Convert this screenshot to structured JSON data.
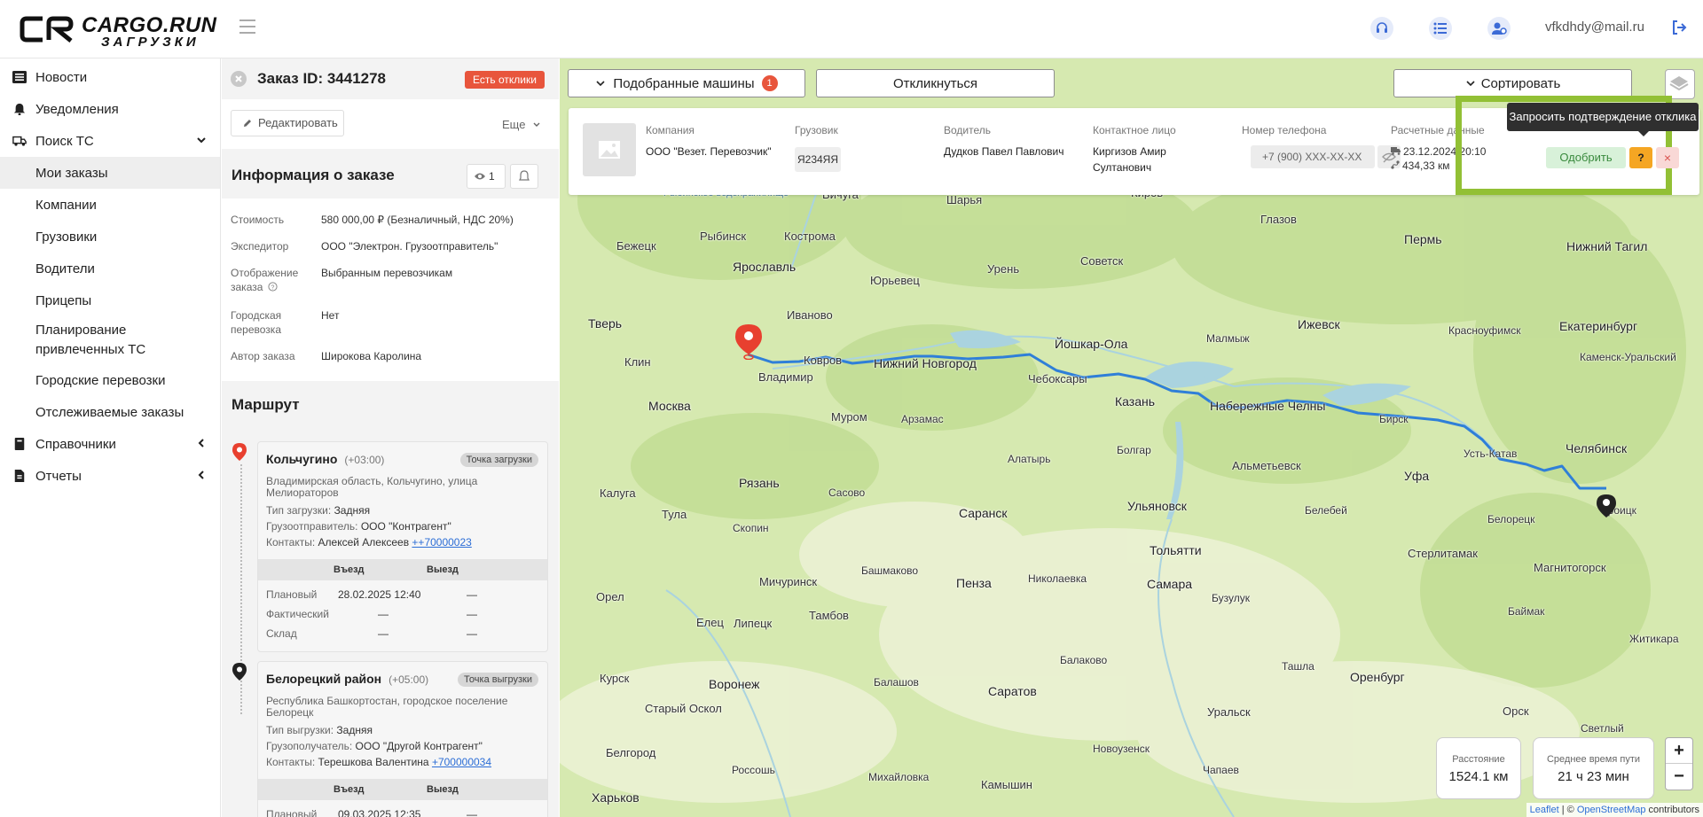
{
  "header": {
    "logo_top": "CARGO.RUN",
    "logo_bottom": "ЗАГРУЗКИ",
    "email": "vfkdhdy@mail.ru",
    "icons": [
      "support-icon",
      "list-icon",
      "user-settings-icon",
      "logout-icon"
    ]
  },
  "sidebar": {
    "items": [
      {
        "label": "Новости",
        "icon": "news-icon"
      },
      {
        "label": "Уведомления",
        "icon": "bell-icon"
      },
      {
        "label": "Поиск ТС",
        "icon": "truck-icon"
      },
      {
        "label": "Мои заказы"
      },
      {
        "label": "Компании"
      },
      {
        "label": "Грузовики"
      },
      {
        "label": "Водители"
      },
      {
        "label": "Прицепы"
      },
      {
        "label": "Планирование привлеченных ТС"
      },
      {
        "label": "Городские перевозки"
      },
      {
        "label": "Отслеживаемые заказы"
      },
      {
        "label": "Справочники",
        "icon": "book-icon"
      },
      {
        "label": "Отчеты",
        "icon": "report-icon"
      }
    ]
  },
  "order": {
    "title": "Заказ ID: 3441278",
    "badge": "Есть отклики",
    "edit_label": "Редактировать",
    "more_label": "Еще",
    "info_title": "Информация о заказе",
    "views": "1",
    "fields": [
      {
        "label": "Стоимость",
        "value": "580 000,00 ₽ (Безналичный, НДС 20%)"
      },
      {
        "label": "Экспедитор",
        "value": "ООО \"Электрон. Грузоотправитель\""
      },
      {
        "label": "Отображение заказа",
        "value": "Выбранным перевозчикам"
      },
      {
        "label": "Городская перевозка",
        "value": "Нет"
      },
      {
        "label": "Автор заказа",
        "value": "Широкова Каролина"
      }
    ],
    "route_title": "Маршрут",
    "points": [
      {
        "city": "Кольчугино",
        "tz": "(+03:00)",
        "type": "Точка загрузки",
        "address": "Владимирская область, Кольчугино, улица Мелиораторов",
        "load_label": "Тип загрузки:",
        "load_value": "Задняя",
        "party_label": "Грузоотправитель:",
        "party_value": "ООО \"Контрагент\"",
        "contacts_label": "Контакты:",
        "contacts_name": "Алексей Алексеев",
        "contacts_phone": "++70000023",
        "col_in": "Въезд",
        "col_out": "Выезд",
        "rows": [
          {
            "label": "Плановый",
            "in": "28.02.2025 12:40",
            "out": "—"
          },
          {
            "label": "Фактический",
            "in": "—",
            "out": "—"
          },
          {
            "label": "Склад",
            "in": "—",
            "out": "—"
          }
        ]
      },
      {
        "city": "Белорецкий район",
        "tz": "(+05:00)",
        "type": "Точка выгрузки",
        "address": "Республика Башкортостан, городское поселение Белорецк",
        "load_label": "Тип выгрузки:",
        "load_value": "Задняя",
        "party_label": "Грузополучатель:",
        "party_value": "ООО \"Другой Контрагент\"",
        "contacts_label": "Контакты:",
        "contacts_name": "Терешкова Валентина",
        "contacts_phone": "+700000034",
        "col_in": "Въезд",
        "col_out": "Выезд",
        "rows": [
          {
            "label": "Плановый",
            "in": "09.03.2025 12:35",
            "out": "—"
          }
        ]
      }
    ]
  },
  "map": {
    "matched_label": "Подобранные машины",
    "matched_count": "1",
    "respond_label": "Откликнуться",
    "sort_label": "Сортировать",
    "response": {
      "h_company": "Компания",
      "h_truck": "Грузовик",
      "h_driver": "Водитель",
      "h_contact": "Контактное лицо",
      "h_phone": "Номер телефона",
      "h_calc": "Расчетные данные",
      "company": "ООО \"Везет. Перевозчик\"",
      "truck": "Я234ЯЯ",
      "driver": "Дудков Павел Павлович",
      "contact": "Киргизов Амир Султанович",
      "phone": "+7 (900) XXX-XX-XX",
      "calc_date": "23.12.2024 20:10",
      "calc_dist": "434,33 км",
      "tooltip": "Запросить подтверждение отклика",
      "approve_label": "Одобрить",
      "q_label": "?",
      "x_label": "×"
    },
    "distance_label": "Расстояние",
    "distance_value": "1524.1 км",
    "time_label": "Среднее время пути",
    "time_value": "21 ч 23 мин",
    "zoom_in": "+",
    "zoom_out": "−",
    "attribution_leaflet": "Leaflet",
    "attribution_sep": " | © ",
    "attribution_osm": "OpenStreetMap",
    "attribution_tail": " contributors",
    "cities": [
      {
        "name": "Рыбинское водохранилище",
        "big": false
      },
      {
        "name": "Вичуга",
        "big": false
      },
      {
        "name": "Шарья",
        "big": false
      },
      {
        "name": "Киров",
        "big": false
      },
      {
        "name": "Глазов",
        "big": false
      },
      {
        "name": "Пермь",
        "big": true
      },
      {
        "name": "Нижний Тагил",
        "big": true
      },
      {
        "name": "Бежецк",
        "big": false
      },
      {
        "name": "Рыбинск",
        "big": false
      },
      {
        "name": "Кострома",
        "big": false
      },
      {
        "name": "Советск",
        "big": false
      },
      {
        "name": "Ярославль",
        "big": true
      },
      {
        "name": "Урень",
        "big": false
      },
      {
        "name": "Юрьевец",
        "big": false
      },
      {
        "name": "Тверь",
        "big": true
      },
      {
        "name": "Иваново",
        "big": false
      },
      {
        "name": "Ижевск",
        "big": true
      },
      {
        "name": "Красноуфимск",
        "big": false
      },
      {
        "name": "Екатеринбург",
        "big": true
      },
      {
        "name": "Клин",
        "big": false
      },
      {
        "name": "Ковров",
        "big": false
      },
      {
        "name": "Нижний Новгород",
        "big": true
      },
      {
        "name": "Йошкар-Ола",
        "big": true
      },
      {
        "name": "Малмыж",
        "big": false
      },
      {
        "name": "Каменск-Уральский",
        "big": false
      },
      {
        "name": "Владимир",
        "big": false
      },
      {
        "name": "Чебоксары",
        "big": false
      },
      {
        "name": "Москва",
        "big": true
      },
      {
        "name": "Муром",
        "big": false
      },
      {
        "name": "Арзамас",
        "big": false
      },
      {
        "name": "Казань",
        "big": true
      },
      {
        "name": "Набережные Челны",
        "big": true
      },
      {
        "name": "Бирск",
        "big": false
      },
      {
        "name": "Усть-Катав",
        "big": false
      },
      {
        "name": "Челябинск",
        "big": true
      },
      {
        "name": "Алатырь",
        "big": false
      },
      {
        "name": "Болгар",
        "big": false
      },
      {
        "name": "Альметьевск",
        "big": false
      },
      {
        "name": "Калуга",
        "big": false
      },
      {
        "name": "Рязань",
        "big": true
      },
      {
        "name": "Уфа",
        "big": true
      },
      {
        "name": "Белорецк",
        "big": false
      },
      {
        "name": "Троицк",
        "big": false
      },
      {
        "name": "Тула",
        "big": false
      },
      {
        "name": "Сасово",
        "big": false
      },
      {
        "name": "Саранск",
        "big": true
      },
      {
        "name": "Ульяновск",
        "big": true
      },
      {
        "name": "Белебей",
        "big": false
      },
      {
        "name": "Скопин",
        "big": false
      },
      {
        "name": "Тольятти",
        "big": true
      },
      {
        "name": "Стерлитамак",
        "big": false
      },
      {
        "name": "Магнитогорск",
        "big": false
      },
      {
        "name": "Башмаково",
        "big": false
      },
      {
        "name": "Николаевка",
        "big": false
      },
      {
        "name": "Мичуринск",
        "big": false
      },
      {
        "name": "Пенза",
        "big": true
      },
      {
        "name": "Самара",
        "big": true
      },
      {
        "name": "Бузулук",
        "big": false
      },
      {
        "name": "Орел",
        "big": false
      },
      {
        "name": "Елец",
        "big": false
      },
      {
        "name": "Липецк",
        "big": false
      },
      {
        "name": "Тамбов",
        "big": false
      },
      {
        "name": "Баймак",
        "big": false
      },
      {
        "name": "Житикара",
        "big": false
      },
      {
        "name": "Балаково",
        "big": false
      },
      {
        "name": "Ташла",
        "big": false
      },
      {
        "name": "Курск",
        "big": false
      },
      {
        "name": "Воронеж",
        "big": true
      },
      {
        "name": "Балашов",
        "big": false
      },
      {
        "name": "Оренбург",
        "big": true
      },
      {
        "name": "Старый Оскол",
        "big": false
      },
      {
        "name": "Саратов",
        "big": true
      },
      {
        "name": "Уральск",
        "big": false
      },
      {
        "name": "Орск",
        "big": false
      },
      {
        "name": "Белгород",
        "big": false
      },
      {
        "name": "Новоузенск",
        "big": false
      },
      {
        "name": "Светлый",
        "big": false
      },
      {
        "name": "Россошь",
        "big": false
      },
      {
        "name": "Михайловка",
        "big": false
      },
      {
        "name": "Чапаев",
        "big": false
      },
      {
        "name": "Харьков",
        "big": true
      },
      {
        "name": "Камышин",
        "big": false
      }
    ]
  }
}
